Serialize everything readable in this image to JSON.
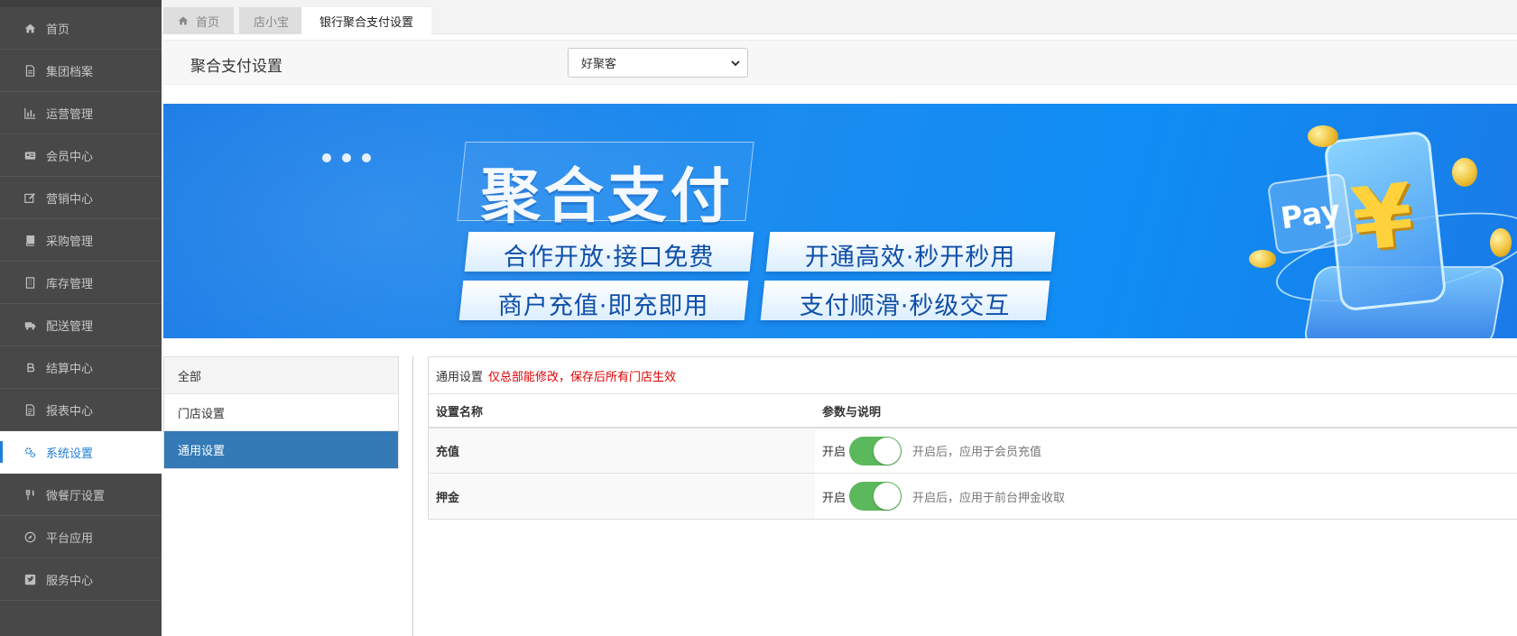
{
  "sidebar": {
    "items": [
      {
        "label": "首页",
        "icon": "home-icon"
      },
      {
        "label": "集团档案",
        "icon": "file-icon"
      },
      {
        "label": "运营管理",
        "icon": "bar-chart-icon"
      },
      {
        "label": "会员中心",
        "icon": "id-card-icon"
      },
      {
        "label": "营销中心",
        "icon": "edit-icon"
      },
      {
        "label": "采购管理",
        "icon": "book-icon"
      },
      {
        "label": "库存管理",
        "icon": "building-icon"
      },
      {
        "label": "配送管理",
        "icon": "truck-icon"
      },
      {
        "label": "结算中心",
        "icon": "bitcoin-icon"
      },
      {
        "label": "报表中心",
        "icon": "report-icon"
      },
      {
        "label": "系统设置",
        "icon": "gears-icon",
        "active": true
      },
      {
        "label": "微餐厅设置",
        "icon": "cutlery-icon"
      },
      {
        "label": "平台应用",
        "icon": "compass-icon"
      },
      {
        "label": "服务中心",
        "icon": "twitter-square-icon"
      }
    ]
  },
  "tabs": [
    {
      "label": "首页"
    },
    {
      "label": "店小宝"
    },
    {
      "label": "银行聚合支付设置",
      "active": true
    }
  ],
  "header": {
    "title": "聚合支付设置",
    "select_value": "好聚客"
  },
  "banner": {
    "title": "聚合支付",
    "pills": [
      "合作开放·接口免费",
      "开通高效·秒开秒用",
      "商户充值·即充即用",
      "支付顺滑·秒级交互"
    ],
    "card_text": "Pay",
    "yen": "¥"
  },
  "left_nav": {
    "items": [
      {
        "label": "全部"
      },
      {
        "label": "门店设置"
      },
      {
        "label": "通用设置",
        "active": true
      }
    ]
  },
  "panel": {
    "title": "通用设置",
    "warning": "仅总部能修改，保存后所有门店生效",
    "columns": [
      "设置名称",
      "参数与说明"
    ],
    "rows": [
      {
        "name": "充值",
        "switch_label": "开启",
        "enabled": true,
        "desc": "开启后，应用于会员充值"
      },
      {
        "name": "押金",
        "switch_label": "开启",
        "enabled": true,
        "desc": "开启后，应用于前台押金收取"
      }
    ]
  },
  "colors": {
    "sidebar_bg": "#474847",
    "accent": "#1e7fd8",
    "nav_active": "#337ab7",
    "switch_on": "#5cb85c",
    "warning": "#e00000"
  }
}
